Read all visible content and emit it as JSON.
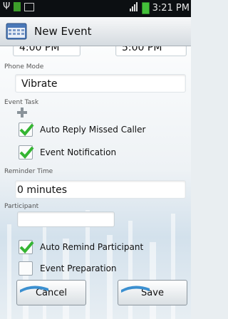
{
  "status_bar": {
    "time": "3:21 PM"
  },
  "header": {
    "title": "New Event"
  },
  "time_range": {
    "start": "4:00 PM",
    "end": "5:00 PM"
  },
  "phone_mode": {
    "label": "Phone Mode",
    "value": "Vibrate"
  },
  "event_task": {
    "label": "Event Task"
  },
  "checkboxes": {
    "auto_reply": {
      "label": "Auto Reply Missed Caller",
      "checked": true
    },
    "event_notification": {
      "label": "Event Notification",
      "checked": true
    },
    "auto_remind": {
      "label": "Auto Remind Participant",
      "checked": true
    },
    "event_preparation": {
      "label": "Event Preparation",
      "checked": false
    }
  },
  "reminder_time": {
    "label": "Reminder Time",
    "value": "0 minutes"
  },
  "participant": {
    "label": "Participant",
    "value": ""
  },
  "buttons": {
    "cancel": "Cancel",
    "save": "Save"
  },
  "colors": {
    "accent_check": "#35b533",
    "battery": "#44c03a",
    "status_bg": "#0c0f12"
  }
}
